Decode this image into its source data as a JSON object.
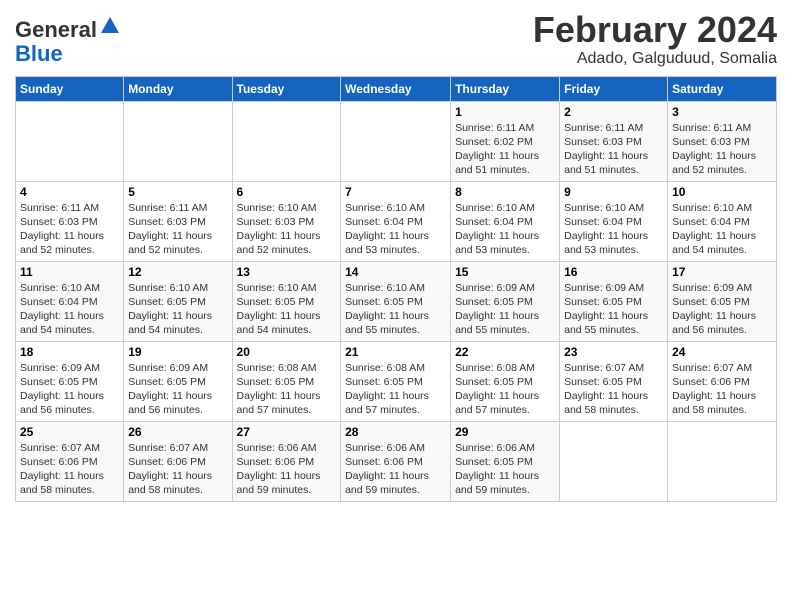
{
  "logo": {
    "general": "General",
    "blue": "Blue"
  },
  "title": "February 2024",
  "subtitle": "Adado, Galguduud, Somalia",
  "days_of_week": [
    "Sunday",
    "Monday",
    "Tuesday",
    "Wednesday",
    "Thursday",
    "Friday",
    "Saturday"
  ],
  "weeks": [
    [
      {
        "day": "",
        "info": ""
      },
      {
        "day": "",
        "info": ""
      },
      {
        "day": "",
        "info": ""
      },
      {
        "day": "",
        "info": ""
      },
      {
        "day": "1",
        "info": "Sunrise: 6:11 AM\nSunset: 6:02 PM\nDaylight: 11 hours and 51 minutes."
      },
      {
        "day": "2",
        "info": "Sunrise: 6:11 AM\nSunset: 6:03 PM\nDaylight: 11 hours and 51 minutes."
      },
      {
        "day": "3",
        "info": "Sunrise: 6:11 AM\nSunset: 6:03 PM\nDaylight: 11 hours and 52 minutes."
      }
    ],
    [
      {
        "day": "4",
        "info": "Sunrise: 6:11 AM\nSunset: 6:03 PM\nDaylight: 11 hours and 52 minutes."
      },
      {
        "day": "5",
        "info": "Sunrise: 6:11 AM\nSunset: 6:03 PM\nDaylight: 11 hours and 52 minutes."
      },
      {
        "day": "6",
        "info": "Sunrise: 6:10 AM\nSunset: 6:03 PM\nDaylight: 11 hours and 52 minutes."
      },
      {
        "day": "7",
        "info": "Sunrise: 6:10 AM\nSunset: 6:04 PM\nDaylight: 11 hours and 53 minutes."
      },
      {
        "day": "8",
        "info": "Sunrise: 6:10 AM\nSunset: 6:04 PM\nDaylight: 11 hours and 53 minutes."
      },
      {
        "day": "9",
        "info": "Sunrise: 6:10 AM\nSunset: 6:04 PM\nDaylight: 11 hours and 53 minutes."
      },
      {
        "day": "10",
        "info": "Sunrise: 6:10 AM\nSunset: 6:04 PM\nDaylight: 11 hours and 54 minutes."
      }
    ],
    [
      {
        "day": "11",
        "info": "Sunrise: 6:10 AM\nSunset: 6:04 PM\nDaylight: 11 hours and 54 minutes."
      },
      {
        "day": "12",
        "info": "Sunrise: 6:10 AM\nSunset: 6:05 PM\nDaylight: 11 hours and 54 minutes."
      },
      {
        "day": "13",
        "info": "Sunrise: 6:10 AM\nSunset: 6:05 PM\nDaylight: 11 hours and 54 minutes."
      },
      {
        "day": "14",
        "info": "Sunrise: 6:10 AM\nSunset: 6:05 PM\nDaylight: 11 hours and 55 minutes."
      },
      {
        "day": "15",
        "info": "Sunrise: 6:09 AM\nSunset: 6:05 PM\nDaylight: 11 hours and 55 minutes."
      },
      {
        "day": "16",
        "info": "Sunrise: 6:09 AM\nSunset: 6:05 PM\nDaylight: 11 hours and 55 minutes."
      },
      {
        "day": "17",
        "info": "Sunrise: 6:09 AM\nSunset: 6:05 PM\nDaylight: 11 hours and 56 minutes."
      }
    ],
    [
      {
        "day": "18",
        "info": "Sunrise: 6:09 AM\nSunset: 6:05 PM\nDaylight: 11 hours and 56 minutes."
      },
      {
        "day": "19",
        "info": "Sunrise: 6:09 AM\nSunset: 6:05 PM\nDaylight: 11 hours and 56 minutes."
      },
      {
        "day": "20",
        "info": "Sunrise: 6:08 AM\nSunset: 6:05 PM\nDaylight: 11 hours and 57 minutes."
      },
      {
        "day": "21",
        "info": "Sunrise: 6:08 AM\nSunset: 6:05 PM\nDaylight: 11 hours and 57 minutes."
      },
      {
        "day": "22",
        "info": "Sunrise: 6:08 AM\nSunset: 6:05 PM\nDaylight: 11 hours and 57 minutes."
      },
      {
        "day": "23",
        "info": "Sunrise: 6:07 AM\nSunset: 6:05 PM\nDaylight: 11 hours and 58 minutes."
      },
      {
        "day": "24",
        "info": "Sunrise: 6:07 AM\nSunset: 6:06 PM\nDaylight: 11 hours and 58 minutes."
      }
    ],
    [
      {
        "day": "25",
        "info": "Sunrise: 6:07 AM\nSunset: 6:06 PM\nDaylight: 11 hours and 58 minutes."
      },
      {
        "day": "26",
        "info": "Sunrise: 6:07 AM\nSunset: 6:06 PM\nDaylight: 11 hours and 58 minutes."
      },
      {
        "day": "27",
        "info": "Sunrise: 6:06 AM\nSunset: 6:06 PM\nDaylight: 11 hours and 59 minutes."
      },
      {
        "day": "28",
        "info": "Sunrise: 6:06 AM\nSunset: 6:06 PM\nDaylight: 11 hours and 59 minutes."
      },
      {
        "day": "29",
        "info": "Sunrise: 6:06 AM\nSunset: 6:05 PM\nDaylight: 11 hours and 59 minutes."
      },
      {
        "day": "",
        "info": ""
      },
      {
        "day": "",
        "info": ""
      }
    ]
  ]
}
